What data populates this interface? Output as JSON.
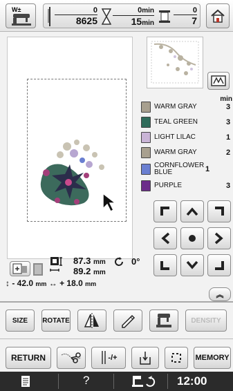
{
  "top_bar": {
    "stitch_current": "0",
    "stitch_total": "8625",
    "time_current": "0",
    "time_total": "15",
    "time_unit": "min",
    "color_current": "0",
    "color_total": "7"
  },
  "thread_list": {
    "header": "min",
    "items": [
      {
        "name": "WARM GRAY",
        "minutes": "3",
        "color": "#a8a08f"
      },
      {
        "name": "TEAL GREEN",
        "minutes": "3",
        "color": "#2f6b5a"
      },
      {
        "name": "LIGHT LILAC",
        "minutes": "1",
        "color": "#c9b4d6"
      },
      {
        "name": "WARM GRAY",
        "minutes": "2",
        "color": "#a8a08f"
      },
      {
        "name": "CORNFLOWER BLUE",
        "minutes": "1",
        "color": "#6a7fd1"
      },
      {
        "name": "PURPLE",
        "minutes": "3",
        "color": "#6c2d8a"
      }
    ]
  },
  "pattern_info": {
    "width": "87.3",
    "height": "89.2",
    "unit": "mm",
    "angle": "0°",
    "offset_v": "- 42.0",
    "offset_h": "+ 18.0"
  },
  "tools": {
    "size": "SIZE",
    "rotate": "ROTATE",
    "density": "DENSITY"
  },
  "bottom": {
    "return": "RETURN",
    "memory": "MEMORY",
    "thread_cut": "-/+",
    "clock": "12:00",
    "help": "?"
  },
  "icons": [
    "sewing-machine-icon",
    "needle-icon",
    "hourglass-icon",
    "spool-icon",
    "home-icon",
    "pointer-icon",
    "scale-icon",
    "rotate-icon",
    "mirror-icon",
    "pencil-icon",
    "frame-icon",
    "clipboard-icon",
    "help-icon",
    "screen-icon"
  ]
}
